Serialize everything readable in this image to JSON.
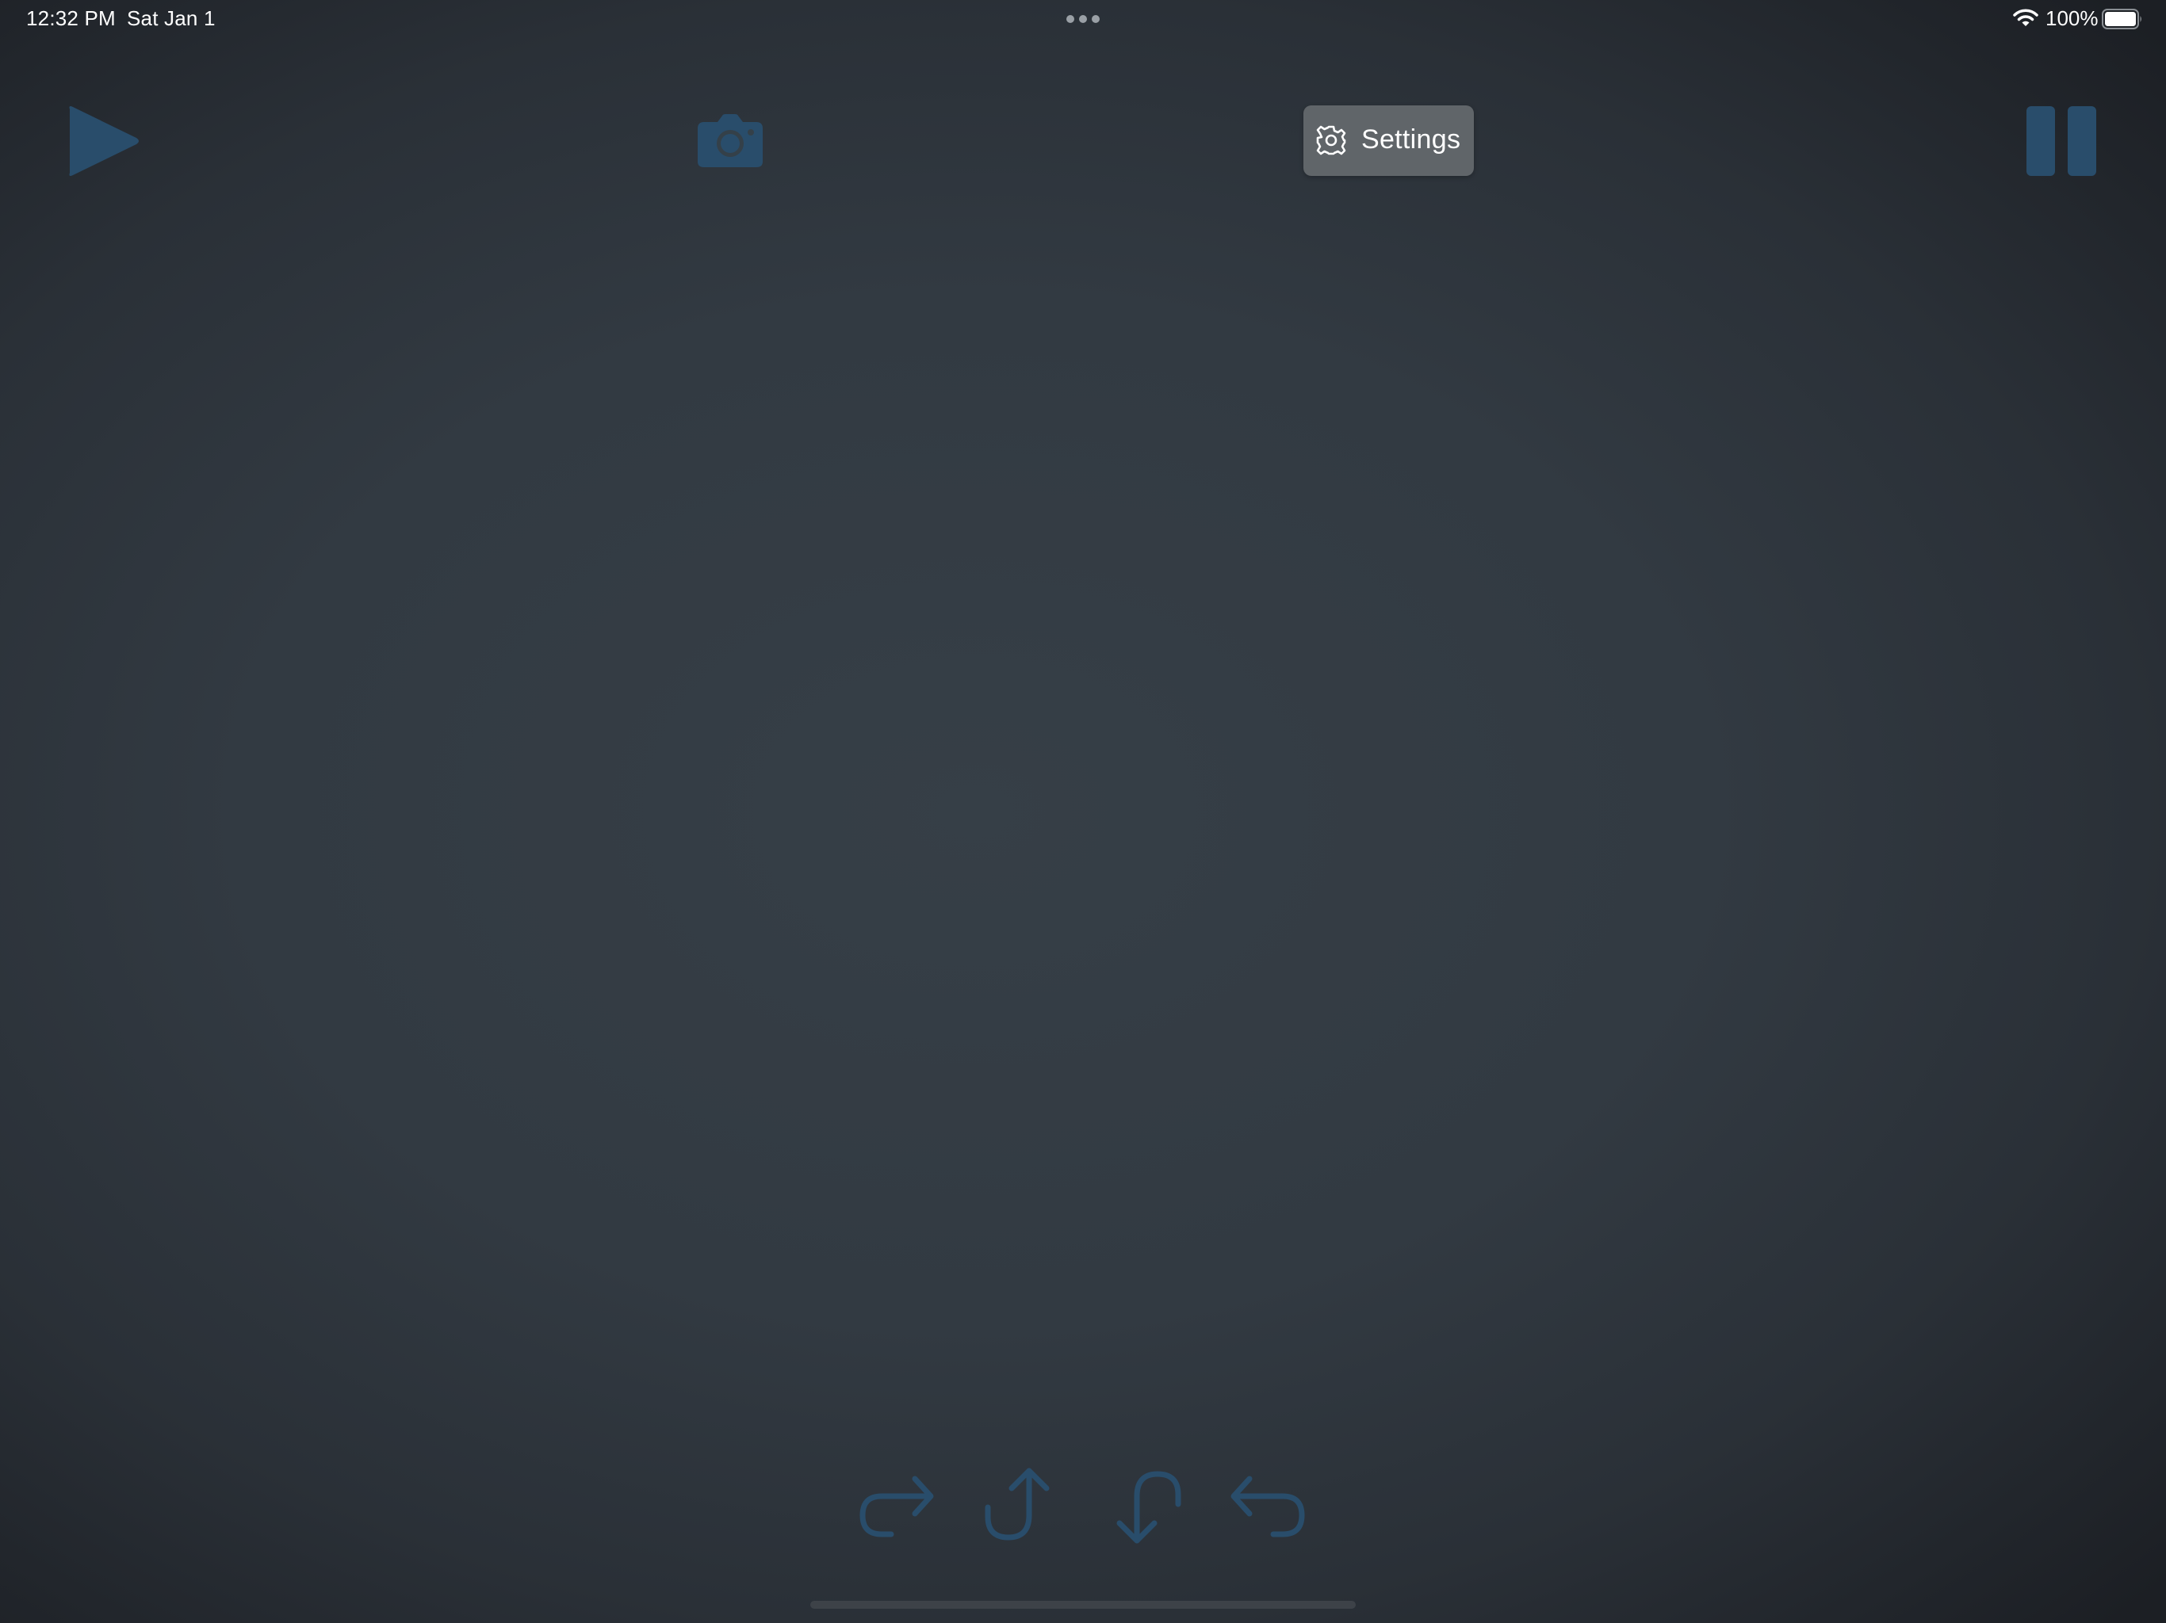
{
  "status_bar": {
    "time": "12:32 PM",
    "date": "Sat Jan 1",
    "battery_percent": "100%",
    "battery_level": 1.0,
    "icons": [
      "more-dots-icon",
      "wifi-icon",
      "battery-icon"
    ]
  },
  "toolbar": {
    "play_icon": "play-icon",
    "camera_icon": "camera-icon",
    "settings_label": "Settings",
    "settings_icon": "gear-icon",
    "pause_icon": "pause-icon"
  },
  "direction_controls": {
    "icons": [
      "turn-right-arrow-icon",
      "up-u-turn-arrow-icon",
      "down-u-turn-arrow-icon",
      "turn-left-arrow-icon"
    ]
  },
  "colors": {
    "accent": "#294d6b",
    "settings_button_bg": "#606569",
    "background": "#323a42"
  }
}
